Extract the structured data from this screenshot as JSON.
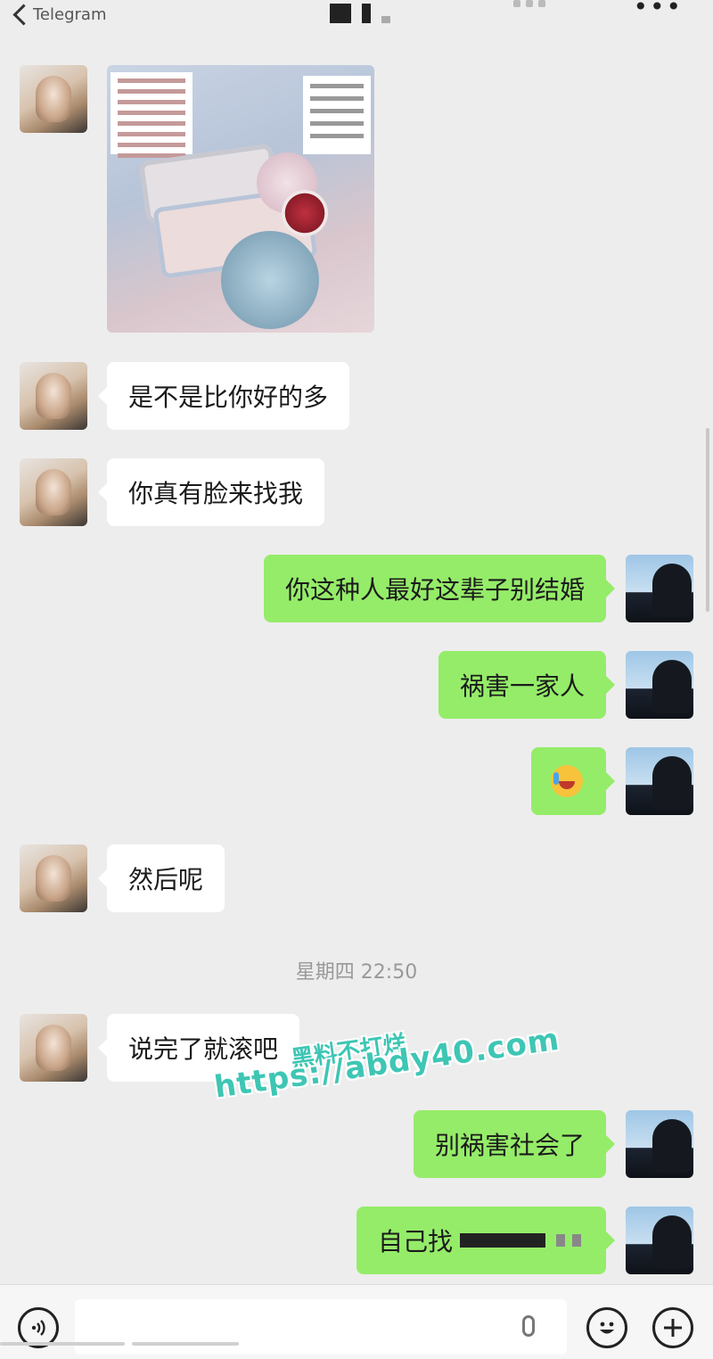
{
  "header": {
    "back_label": "Telegram",
    "more_icon": "more-dots-icon"
  },
  "messages": [
    {
      "side": "in",
      "type": "image",
      "content": "cosmetics-photo"
    },
    {
      "side": "in",
      "type": "text",
      "text": "是不是比你好的多"
    },
    {
      "side": "in",
      "type": "text",
      "text": "你真有脸来找我"
    },
    {
      "side": "out",
      "type": "text",
      "text": "你这种人最好这辈子别结婚"
    },
    {
      "side": "out",
      "type": "text",
      "text": "祸害一家人"
    },
    {
      "side": "out",
      "type": "emoji",
      "content": "crying-laughing-emoji-icon"
    },
    {
      "side": "in",
      "type": "text",
      "text": "然后呢"
    },
    {
      "side": "in",
      "type": "text",
      "text": "说完了就滚吧"
    },
    {
      "side": "out",
      "type": "text",
      "text": "别祸害社会了"
    },
    {
      "side": "out",
      "type": "text",
      "text": "自己找"
    }
  ],
  "timestamp": "星期四 22:50",
  "watermark": {
    "line1": "黑料不打烊",
    "line2": "https://abdy40.com"
  },
  "colors": {
    "background": "#ededed",
    "incoming_bubble": "#ffffff",
    "outgoing_bubble": "#95ec69",
    "watermark": "#3ec6b4"
  },
  "toolbar": {
    "voice_icon": "voice-icon",
    "mic_icon": "mic-icon",
    "emoji_icon": "emoji-icon",
    "plus_icon": "plus-icon"
  }
}
